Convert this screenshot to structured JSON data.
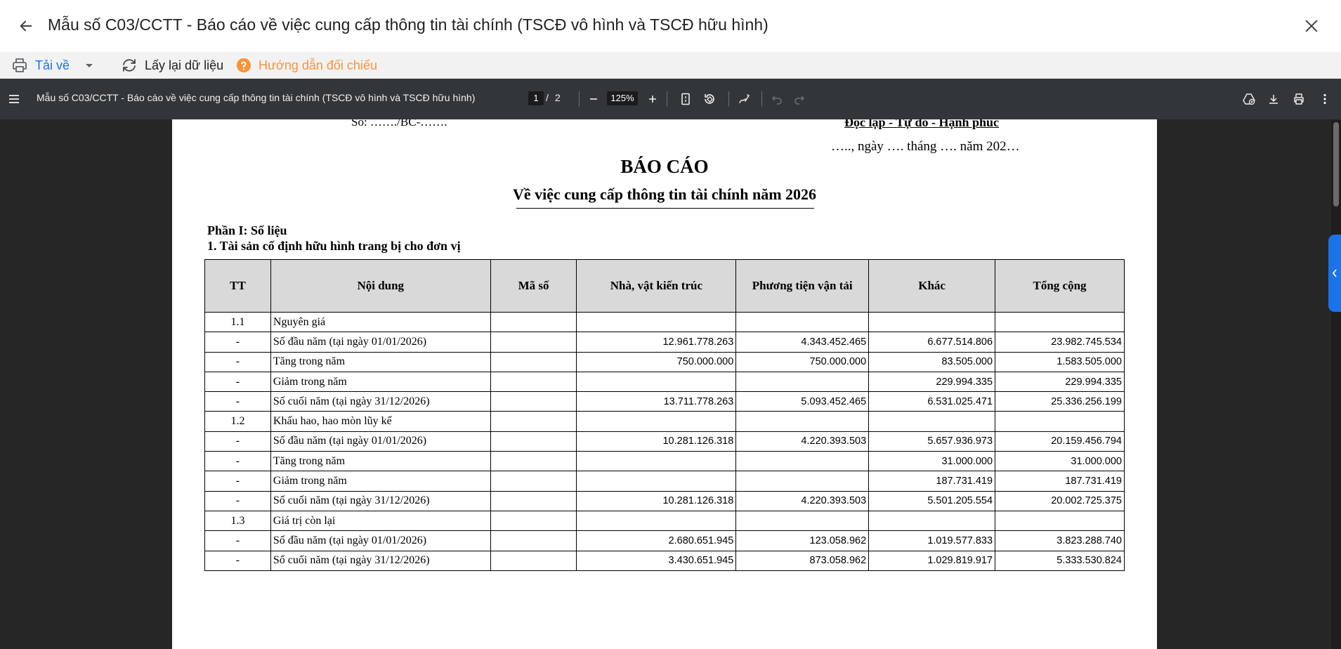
{
  "header": {
    "title": "Mẫu số C03/CCTT - Báo cáo về việc cung cấp thông tin tài chính (TSCĐ vô hình và TSCĐ hữu hình)",
    "back_icon": "arrow-left-icon",
    "close_icon": "close-icon"
  },
  "toolbar": {
    "download_label": "Tải về",
    "reload_label": "Lấy lại dữ liệu",
    "guide_label": "Hướng dẫn đối chiếu",
    "accent_color": "#1a73e8",
    "guide_color": "#f7943b"
  },
  "pdf_bar": {
    "title": "Mẫu số C03/CCTT - Báo cáo về việc cung cấp thông tin tài chính (TSCĐ vô hình và TSCĐ hữu hình)",
    "current_page": "1",
    "separator": "/",
    "total_pages": "2",
    "zoom": "125%"
  },
  "document": {
    "so_line": "Số: ……./BC-…….",
    "motto": "Độc lập - Tự do - Hạnh phúc",
    "date_line": "….., ngày …. tháng …. năm 202…",
    "title": "BÁO CÁO",
    "subtitle": "Về việc cung cấp thông tin tài chính năm 2026",
    "part1": "Phần I: Số liệu",
    "section1": "1. Tài sản cố định hữu hình trang bị cho đơn vị",
    "table": {
      "headers": [
        "TT",
        "Nội dung",
        "Mã số",
        "Nhà, vật kiến trúc",
        "Phương tiện vận tải",
        "Khác",
        "Tổng cộng"
      ],
      "rows": [
        {
          "tt": "1.1",
          "content": "Nguyên giá",
          "code": "",
          "v1": "",
          "v2": "",
          "v3": "",
          "v4": ""
        },
        {
          "tt": "-",
          "content": "Số đầu năm (tại ngày 01/01/2026)",
          "code": "",
          "v1": "12.961.778.263",
          "v2": "4.343.452.465",
          "v3": "6.677.514.806",
          "v4": "23.982.745.534"
        },
        {
          "tt": "-",
          "content": "Tăng trong năm",
          "code": "",
          "v1": "750.000.000",
          "v2": "750.000.000",
          "v3": "83.505.000",
          "v4": "1.583.505.000"
        },
        {
          "tt": "-",
          "content": "Giảm trong năm",
          "code": "",
          "v1": "",
          "v2": "",
          "v3": "229.994.335",
          "v4": "229.994.335"
        },
        {
          "tt": "-",
          "content": "Số cuối năm (tại ngày 31/12/2026)",
          "code": "",
          "v1": "13.711.778.263",
          "v2": "5.093.452.465",
          "v3": "6.531.025.471",
          "v4": "25.336.256.199"
        },
        {
          "tt": "1.2",
          "content": "Khấu hao, hao mòn lũy kế",
          "code": "",
          "v1": "",
          "v2": "",
          "v3": "",
          "v4": ""
        },
        {
          "tt": "-",
          "content": "Số đầu năm (tại ngày 01/01/2026)",
          "code": "",
          "v1": "10.281.126.318",
          "v2": "4.220.393.503",
          "v3": "5.657.936.973",
          "v4": "20.159.456.794"
        },
        {
          "tt": "-",
          "content": "Tăng trong năm",
          "code": "",
          "v1": "",
          "v2": "",
          "v3": "31.000.000",
          "v4": "31.000.000"
        },
        {
          "tt": "-",
          "content": "Giảm trong năm",
          "code": "",
          "v1": "",
          "v2": "",
          "v3": "187.731.419",
          "v4": "187.731.419"
        },
        {
          "tt": "-",
          "content": "Số cuối năm (tại ngày 31/12/2026)",
          "code": "",
          "v1": "10.281.126.318",
          "v2": "4.220.393.503",
          "v3": "5.501.205.554",
          "v4": "20.002.725.375"
        },
        {
          "tt": "1.3",
          "content": "Giá trị còn lại",
          "code": "",
          "v1": "",
          "v2": "",
          "v3": "",
          "v4": ""
        },
        {
          "tt": "-",
          "content": "Số đầu năm (tại ngày 01/01/2026)",
          "code": "",
          "v1": "2.680.651.945",
          "v2": "123.058.962",
          "v3": "1.019.577.833",
          "v4": "3.823.288.740"
        },
        {
          "tt": "-",
          "content": "Số cuối năm (tại ngày 31/12/2026)",
          "code": "",
          "v1": "3.430.651.945",
          "v2": "873.058.962",
          "v3": "1.029.819.917",
          "v4": "5.333.530.824"
        }
      ]
    }
  }
}
